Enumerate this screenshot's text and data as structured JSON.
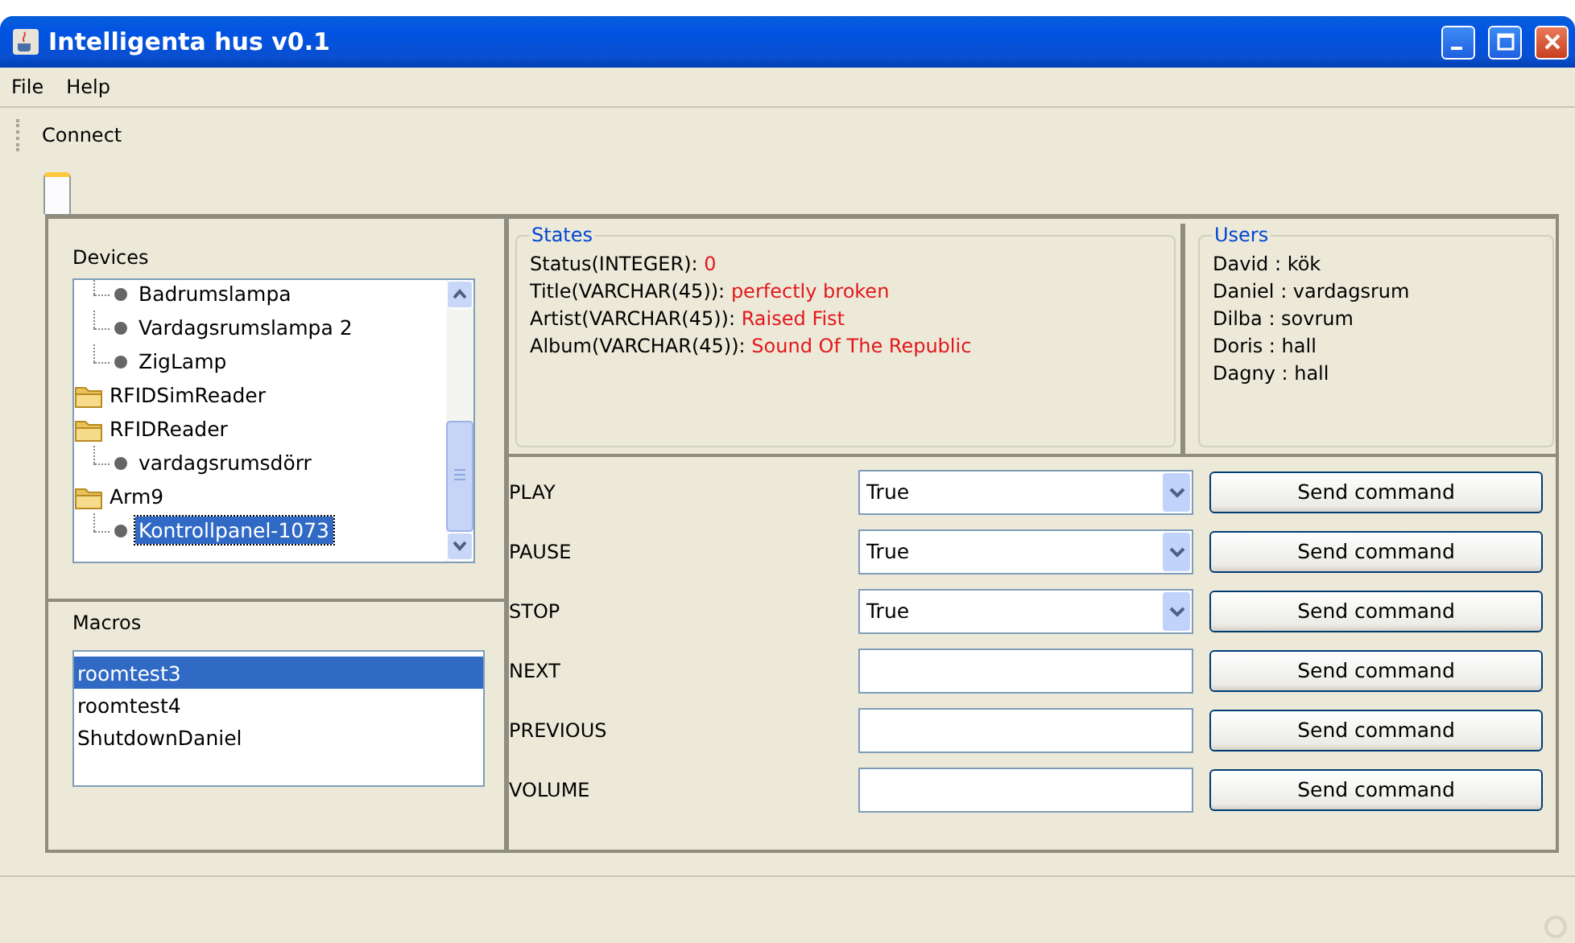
{
  "window": {
    "title": "Intelligenta hus v0.1"
  },
  "menu": [
    {
      "label": "File"
    },
    {
      "label": "Help"
    }
  ],
  "toolbar": [
    {
      "label": "Connect"
    }
  ],
  "devices": {
    "title": "Devices",
    "scrolled_children": [
      {
        "label": "Badrumslampa",
        "selected": false
      },
      {
        "label": "Vardagsrumslampa 2",
        "selected": false
      },
      {
        "label": "ZigLamp",
        "selected": false
      }
    ],
    "folders": [
      {
        "label": "RFIDSimReader",
        "selected": false
      },
      {
        "label": "RFIDReader",
        "selected": false,
        "children": [
          {
            "label": "vardagsrumsdörr",
            "selected": false
          }
        ]
      },
      {
        "label": "Arm9",
        "selected": false,
        "children": [
          {
            "label": "Kontrollpanel-1073",
            "selected": true
          }
        ]
      }
    ]
  },
  "macros": {
    "title": "Macros",
    "items": [
      {
        "label": "roomtest3",
        "selected": true
      },
      {
        "label": "roomtest4",
        "selected": false
      },
      {
        "label": "ShutdownDaniel",
        "selected": false
      }
    ]
  },
  "states": {
    "title": "States",
    "rows": [
      {
        "name": "Status(INTEGER):",
        "value": "0"
      },
      {
        "name": "Title(VARCHAR(45)):",
        "value": "perfectly broken"
      },
      {
        "name": "Artist(VARCHAR(45)):",
        "value": "Raised Fist"
      },
      {
        "name": "Album(VARCHAR(45)):",
        "value": "Sound Of The Republic"
      }
    ]
  },
  "users": {
    "title": "Users",
    "rows": [
      "David : kök",
      "Daniel : vardagsrum",
      "Dilba : sovrum",
      "Doris : hall",
      "Dagny : hall"
    ]
  },
  "commands": [
    {
      "name": "PLAY",
      "kind": "select",
      "value": "True",
      "button": "Send command"
    },
    {
      "name": "PAUSE",
      "kind": "select",
      "value": "True",
      "button": "Send command"
    },
    {
      "name": "STOP",
      "kind": "select",
      "value": "True",
      "button": "Send command"
    },
    {
      "name": "NEXT",
      "kind": "text",
      "button": "Send command"
    },
    {
      "name": "PREVIOUS",
      "kind": "text",
      "button": "Send command"
    },
    {
      "name": "VOLUME",
      "kind": "text",
      "button": "Send command"
    }
  ]
}
